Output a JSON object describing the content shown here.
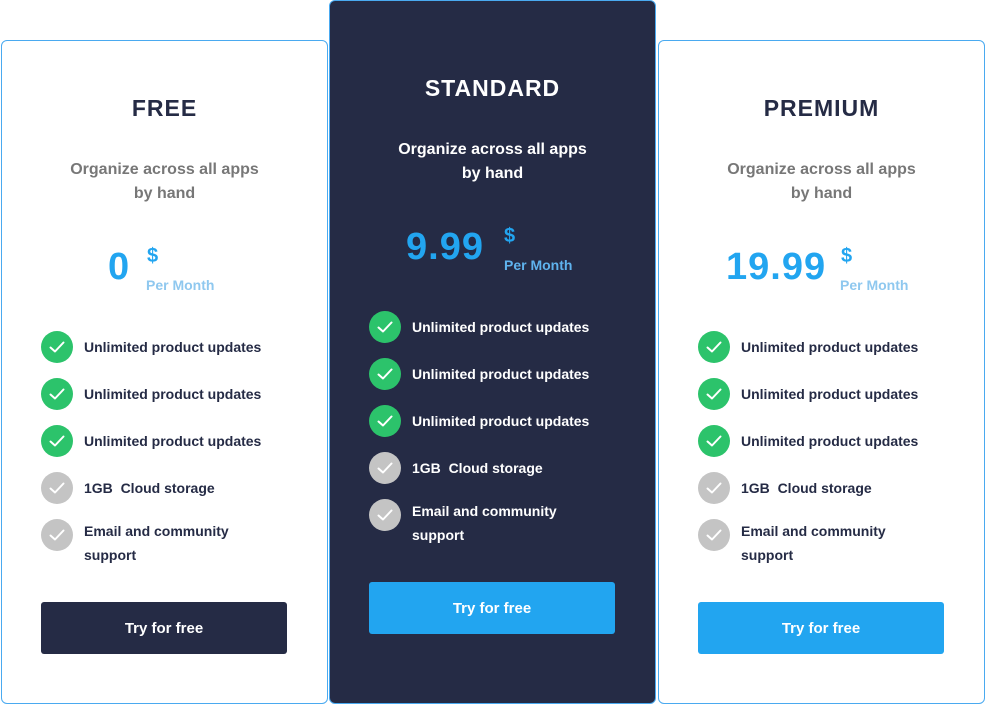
{
  "colors": {
    "navy": "#252b45",
    "accent_blue": "#22a5f0",
    "check_green": "#2cc36b",
    "check_gray": "#c4c4c4",
    "border": "#4aaaf0"
  },
  "plans": [
    {
      "name": "FREE",
      "description": "Organize across all apps by hand",
      "price": "0",
      "currency": "$",
      "period": "Per Month",
      "features": [
        {
          "label": "Unlimited product updates",
          "included": true,
          "icon": "check-icon"
        },
        {
          "label": "Unlimited product updates",
          "included": true,
          "icon": "check-icon"
        },
        {
          "label": "Unlimited product updates",
          "included": true,
          "icon": "check-icon"
        },
        {
          "label": "1GB  Cloud storage",
          "included": false,
          "icon": "check-icon"
        },
        {
          "label": "Email and community support",
          "included": false,
          "icon": "check-icon"
        }
      ],
      "cta_label": "Try for free"
    },
    {
      "name": "STANDARD",
      "description": "Organize across all apps by hand",
      "price": "9.99",
      "currency": "$",
      "period": "Per Month",
      "features": [
        {
          "label": "Unlimited product updates",
          "included": true,
          "icon": "check-icon"
        },
        {
          "label": "Unlimited product updates",
          "included": true,
          "icon": "check-icon"
        },
        {
          "label": "Unlimited product updates",
          "included": true,
          "icon": "check-icon"
        },
        {
          "label": "1GB  Cloud storage",
          "included": false,
          "icon": "check-icon"
        },
        {
          "label": "Email and community support",
          "included": false,
          "icon": "check-icon"
        }
      ],
      "cta_label": "Try for free"
    },
    {
      "name": "PREMIUM",
      "description": "Organize across all apps by hand",
      "price": "19.99",
      "currency": "$",
      "period": "Per Month",
      "features": [
        {
          "label": "Unlimited product updates",
          "included": true,
          "icon": "check-icon"
        },
        {
          "label": "Unlimited product updates",
          "included": true,
          "icon": "check-icon"
        },
        {
          "label": "Unlimited product updates",
          "included": true,
          "icon": "check-icon"
        },
        {
          "label": "1GB  Cloud storage",
          "included": false,
          "icon": "check-icon"
        },
        {
          "label": "Email and community support",
          "included": false,
          "icon": "check-icon"
        }
      ],
      "cta_label": "Try for free"
    }
  ]
}
